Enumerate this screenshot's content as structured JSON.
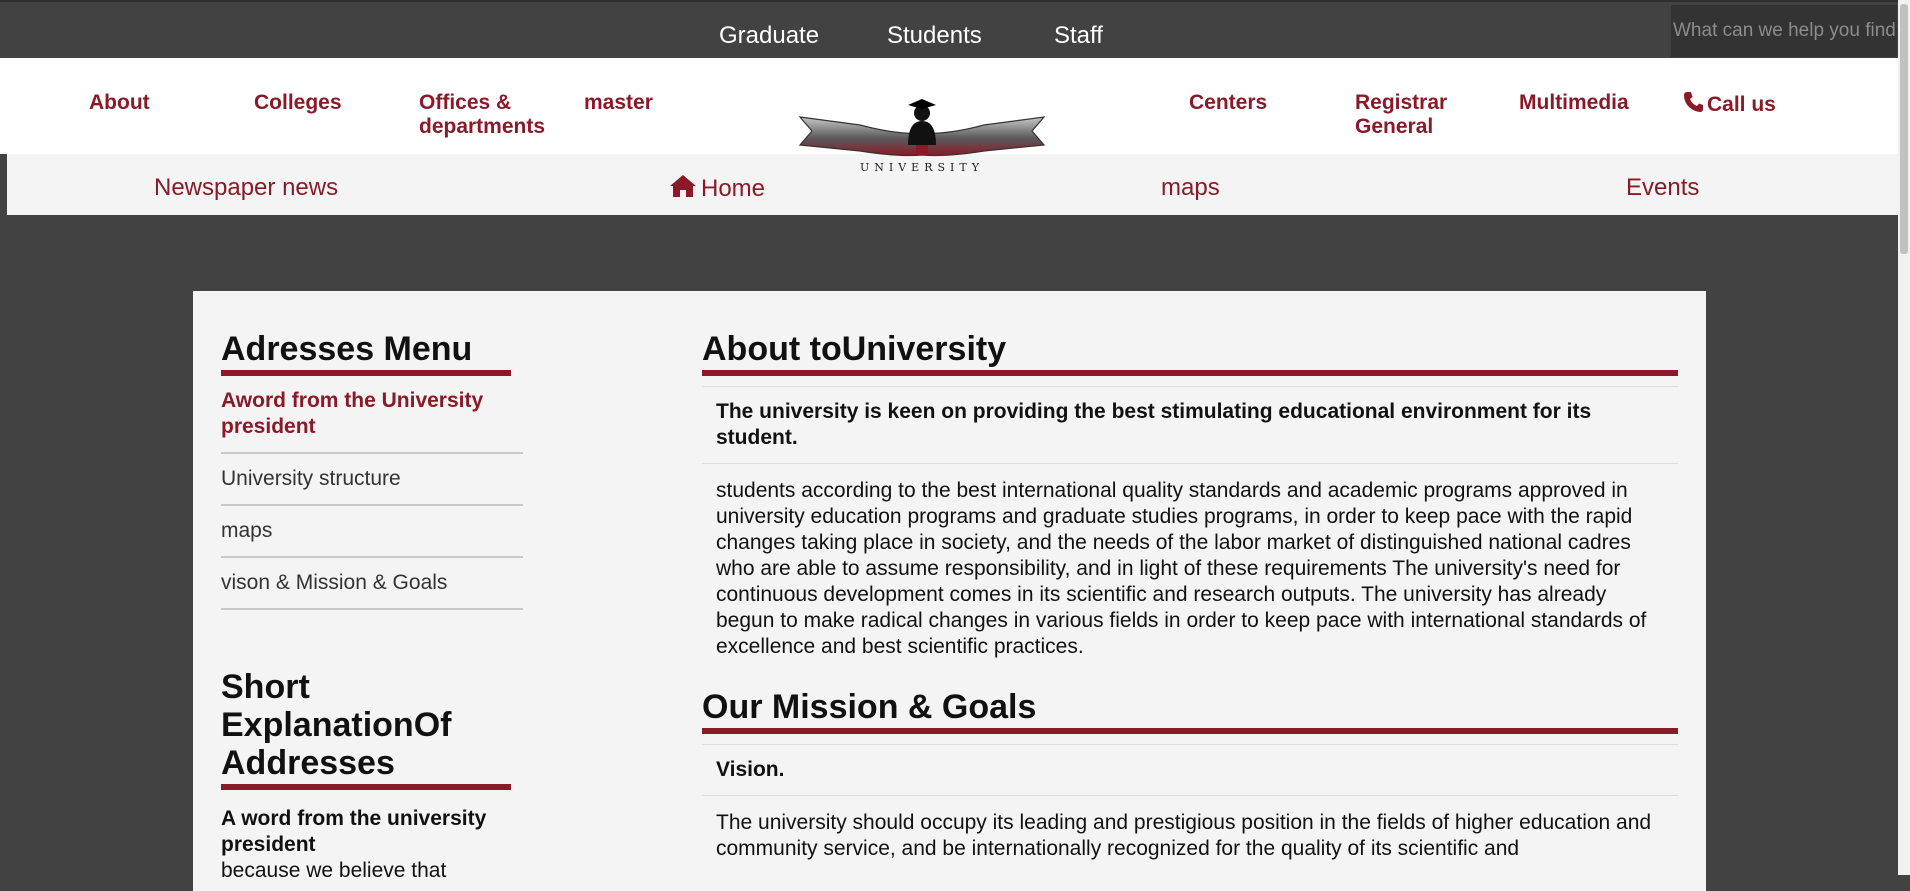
{
  "topbar": {
    "links": [
      "Graduate",
      "Students",
      "Staff"
    ],
    "search_placeholder": "What can we help you find?"
  },
  "mainnav": {
    "left": [
      "About",
      "Colleges",
      "Offices &\ndepartments",
      "master"
    ],
    "right": [
      "Centers",
      "Registrar\nGeneral",
      "Multimedia"
    ],
    "call": "Call us",
    "logo_text": "UNIVERSITY"
  },
  "subnav": {
    "items": [
      "Newspaper news",
      "Home",
      "maps",
      "Events"
    ]
  },
  "sidebar": {
    "title": "Adresses Menu",
    "items": [
      "Aword from the University president",
      "University structure",
      "maps",
      "vison & Mission & Goals"
    ],
    "title2": "Short ExplanationOf Addresses",
    "sub_bold": "A word from the university president",
    "sub_text": "because we believe that"
  },
  "main": {
    "h1": "About toUniversity",
    "lead": "The university is keen on providing the best stimulating educational environment for its student.",
    "para": "students according to the best international quality standards and academic programs approved in university education programs and graduate studies programs, in order to keep pace with the rapid changes taking place in society, and the needs of the labor market of distinguished national cadres who are able to assume responsibility, and in light of these requirements The university's need for continuous development comes in its scientific and research outputs. The university has already begun to make radical changes in various fields in order to keep pace with international standards of excellence and best scientific practices.",
    "h2": "Our Mission & Goals",
    "lead2": "Vision.",
    "para2": "The university should occupy its leading and prestigious position in the fields of higher education and community service, and be internationally recognized for the quality of its scientific and"
  },
  "colors": {
    "brand": "#8b1a28",
    "dark": "#424242",
    "panel": "#f4f4f4"
  }
}
